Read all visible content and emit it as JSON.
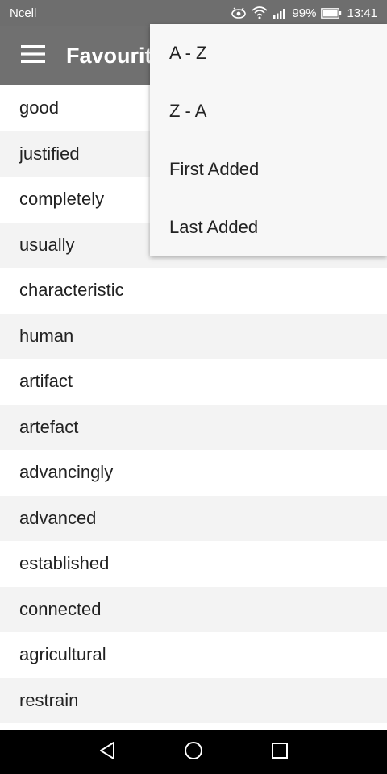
{
  "status_bar": {
    "carrier": "Ncell",
    "battery": "99%",
    "time": "13:41",
    "icons": [
      "eye-icon",
      "wifi-icon",
      "signal-icon",
      "battery-icon"
    ]
  },
  "app_bar": {
    "title": "Favourites",
    "menu_icon": "hamburger-icon"
  },
  "words": [
    "good",
    "justified",
    "completely",
    "usually",
    "characteristic",
    "human",
    "artifact",
    "artefact",
    "advancingly",
    "advanced",
    "established",
    "connected",
    "agricultural",
    "restrain"
  ],
  "sort_menu": {
    "items": [
      "A - Z",
      "Z - A",
      "First Added",
      "Last Added"
    ]
  },
  "nav_bar": {
    "icons": [
      "back-icon",
      "home-icon",
      "recents-icon"
    ]
  },
  "colors": {
    "app_bar": "#707070",
    "status_bar": "#6e6e6e",
    "row_alt": "#f3f3f3",
    "menu_bg": "#f7f7f7"
  }
}
